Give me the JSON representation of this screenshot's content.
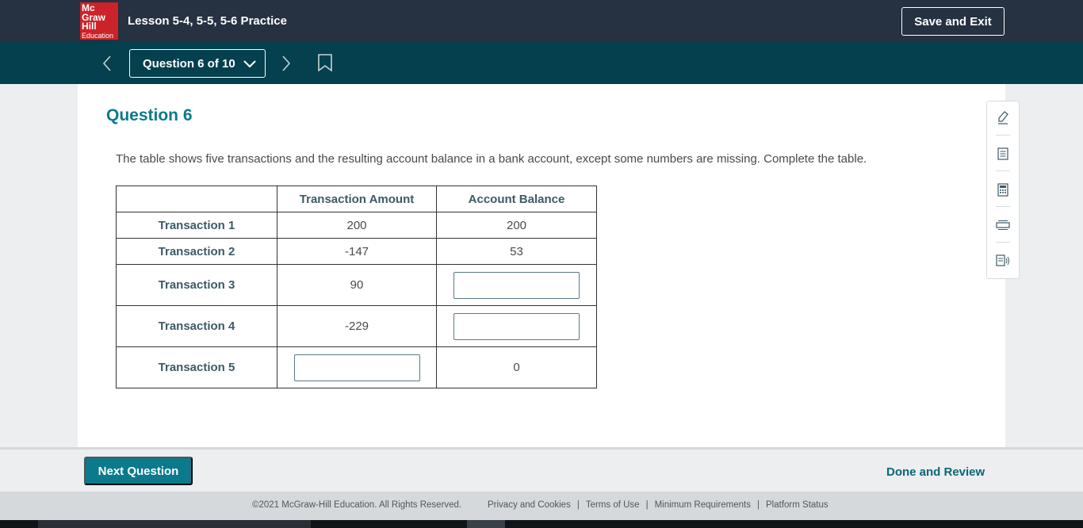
{
  "header": {
    "logo_lines": [
      "Mc",
      "Graw",
      "Hill",
      "Education"
    ],
    "lesson_title": "Lesson 5-4, 5-5, 5-6 Practice",
    "save_exit_label": "Save and Exit"
  },
  "nav": {
    "question_selector": "Question 6 of 10"
  },
  "question": {
    "heading": "Question 6",
    "prompt": "The table shows five transactions and the resulting account balance in a bank account, except some numbers are missing. Complete the table.",
    "table": {
      "headers": [
        "",
        "Transaction Amount",
        "Account Balance"
      ],
      "rows": [
        {
          "label": "Transaction 1",
          "amount": "200",
          "balance": "200"
        },
        {
          "label": "Transaction 2",
          "amount": "-147",
          "balance": "53"
        },
        {
          "label": "Transaction 3",
          "amount": "90",
          "balance": ""
        },
        {
          "label": "Transaction 4",
          "amount": "-229",
          "balance": ""
        },
        {
          "label": "Transaction 5",
          "amount": "",
          "balance": "0"
        }
      ]
    }
  },
  "tools": [
    "highlighter-icon",
    "notepad-icon",
    "calculator-icon",
    "line-reader-icon",
    "text-to-speech-icon"
  ],
  "actions": {
    "next_question_label": "Next Question",
    "done_review_label": "Done and Review"
  },
  "footer": {
    "copyright": "©2021 McGraw-Hill Education. All Rights Reserved.",
    "links": [
      "Privacy and Cookies",
      "Terms of Use",
      "Minimum Requirements",
      "Platform Status"
    ]
  },
  "colors": {
    "header_bg": "#263142",
    "nav_bg": "#04404d",
    "accent": "#0b7a8c",
    "logo_red": "#cc2229"
  }
}
